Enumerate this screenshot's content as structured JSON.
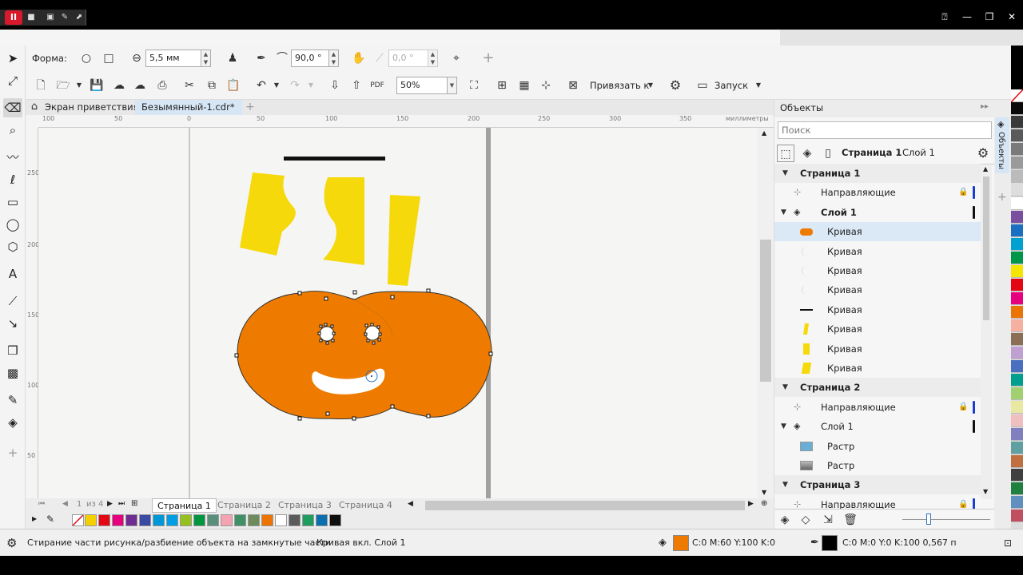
{
  "window": {
    "rec_badge": "II"
  },
  "property_bar": {
    "shape_label": "Форма:",
    "outline_width": "5,5 мм",
    "angle": "90,0 °",
    "angle2": "0,0 °"
  },
  "standard_bar": {
    "zoom": "50%",
    "snap_label": "Привязать к",
    "launch_label": "Запуск"
  },
  "doc_tabs": {
    "welcome": "Экран приветствия",
    "document": "Безымянный-1.cdr*"
  },
  "ruler": {
    "h_labels": [
      "100",
      "50",
      "0",
      "50",
      "100",
      "150",
      "200",
      "250",
      "300",
      "350"
    ],
    "unit": "миллиметры",
    "v_labels": [
      "250",
      "200",
      "150",
      "100",
      "50"
    ]
  },
  "pages_nav": {
    "counter": "1",
    "of": "из 4",
    "tabs": [
      "Страница 1",
      "Страница 2",
      "Страница 3",
      "Страница 4"
    ]
  },
  "palette_bottom": [
    "#f5d000",
    "#e30613",
    "#e6007e",
    "#6f2c91",
    "#3b4ba3",
    "#0097d7",
    "#009fe3",
    "#95c11f",
    "#00963f",
    "#5a8f7b",
    "#f4a3b0",
    "#3f8f67",
    "#6e8b5c",
    "#ec7404",
    "#ffffff",
    "#5b5b5b",
    "#1e9e5e",
    "#0a6fb0",
    "#0f0f0f"
  ],
  "palette_right": [
    "#0a0a0a",
    "#3a3a3a",
    "#5a5a5a",
    "#7a7a7a",
    "#9a9a9a",
    "#bbbbbb",
    "#dddddd",
    "#ffffff",
    "#7a4fa0",
    "#1a6fc0",
    "#00a0d0",
    "#00964a",
    "#f5e500",
    "#e30613",
    "#e6007e",
    "#ec7404",
    "#f6b0a0",
    "#8a6f55",
    "#c0a0d0",
    "#4a6fc0",
    "#009e8f",
    "#a0d070",
    "#e8e8a0",
    "#f0c0c0",
    "#8080c0",
    "#60a0a0",
    "#c07040",
    "#404040",
    "#208040",
    "#6090c0",
    "#c05060",
    "#00c0e0"
  ],
  "objects_panel": {
    "title": "Объекты",
    "search_placeholder": "Поиск",
    "header_page": "Страница 1",
    "header_layer": "Слой 1",
    "dock_tab": "Объекты",
    "rows": [
      {
        "label": "Страница 1",
        "bold": true
      },
      {
        "label": "Направляющие"
      },
      {
        "label": "Слой 1",
        "bold": true
      },
      {
        "label": "Кривая"
      },
      {
        "label": "Кривая"
      },
      {
        "label": "Кривая"
      },
      {
        "label": "Кривая"
      },
      {
        "label": "Кривая"
      },
      {
        "label": "Кривая"
      },
      {
        "label": "Кривая"
      },
      {
        "label": "Кривая"
      },
      {
        "label": "Страница 2",
        "bold": true
      },
      {
        "label": "Направляющие"
      },
      {
        "label": "Слой 1"
      },
      {
        "label": "Растр"
      },
      {
        "label": "Растр"
      },
      {
        "label": "Страница 3",
        "bold": true
      },
      {
        "label": "Направляющие"
      }
    ]
  },
  "status": {
    "hint": "Стирание части рисунка/разбиение объекта на замкнутые части",
    "object_info": "Кривая вкл. Слой 1",
    "fill_info": "C:0 M:60 Y:100 K:0",
    "outline_info": "C:0 M:0 Y:0 K:100  0,567 п"
  },
  "colors": {
    "orange": "#ee7b00",
    "yellow": "#f5d90a",
    "selection": "#dbe9f6"
  }
}
